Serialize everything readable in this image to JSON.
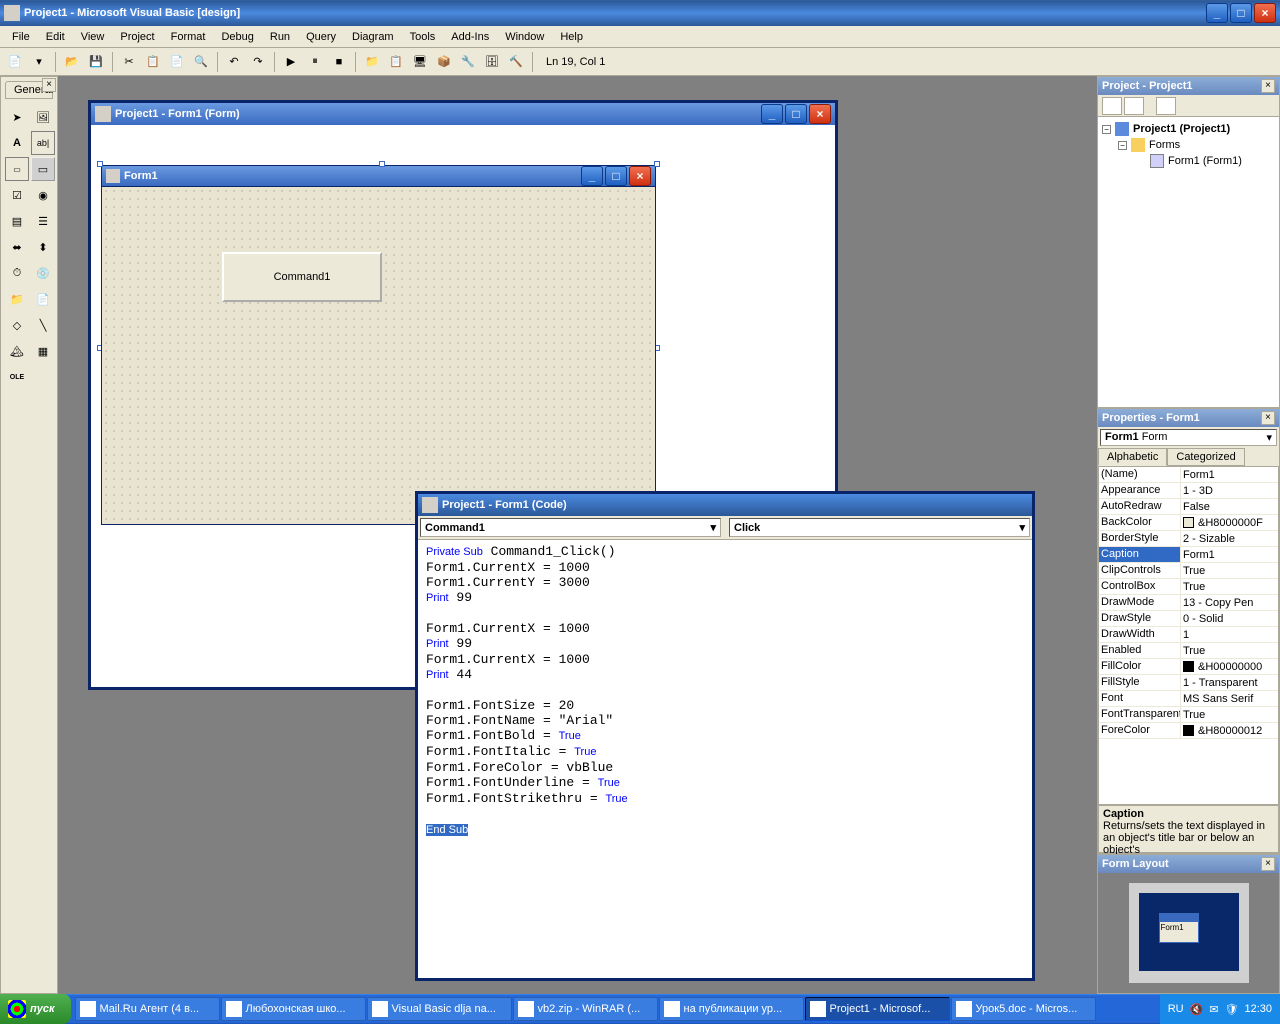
{
  "title": "Project1 - Microsoft Visual Basic [design]",
  "menu": [
    "File",
    "Edit",
    "View",
    "Project",
    "Format",
    "Debug",
    "Run",
    "Query",
    "Diagram",
    "Tools",
    "Add-Ins",
    "Window",
    "Help"
  ],
  "cursor_status": "Ln 19, Col 1",
  "toolbox_tab": "General",
  "designer_title": "Project1 - Form1 (Form)",
  "form_caption": "Form1",
  "command_caption": "Command1",
  "code_title": "Project1 - Form1 (Code)",
  "code_object": "Command1",
  "code_event": "Click",
  "code_lines": [
    {
      "t": "kw",
      "s": "Private Sub"
    },
    {
      "t": "",
      "s": " Command1_Click()"
    },
    {
      "t": "br"
    },
    {
      "t": "",
      "s": "Form1.CurrentX = 1000"
    },
    {
      "t": "br"
    },
    {
      "t": "",
      "s": "Form1.CurrentY = 3000"
    },
    {
      "t": "br"
    },
    {
      "t": "kw",
      "s": "Print"
    },
    {
      "t": "",
      "s": " 99"
    },
    {
      "t": "br"
    },
    {
      "t": "br"
    },
    {
      "t": "",
      "s": "Form1.CurrentX = 1000"
    },
    {
      "t": "br"
    },
    {
      "t": "kw",
      "s": "Print"
    },
    {
      "t": "",
      "s": " 99"
    },
    {
      "t": "br"
    },
    {
      "t": "",
      "s": "Form1.CurrentX = 1000"
    },
    {
      "t": "br"
    },
    {
      "t": "kw",
      "s": "Print"
    },
    {
      "t": "",
      "s": " 44"
    },
    {
      "t": "br"
    },
    {
      "t": "br"
    },
    {
      "t": "",
      "s": "Form1.FontSize = 20"
    },
    {
      "t": "br"
    },
    {
      "t": "",
      "s": "Form1.FontName = \"Arial\""
    },
    {
      "t": "br"
    },
    {
      "t": "",
      "s": "Form1.FontBold = "
    },
    {
      "t": "kw",
      "s": "True"
    },
    {
      "t": "br"
    },
    {
      "t": "",
      "s": "Form1.FontItalic = "
    },
    {
      "t": "kw",
      "s": "True"
    },
    {
      "t": "br"
    },
    {
      "t": "",
      "s": "Form1.ForeColor = vbBlue"
    },
    {
      "t": "br"
    },
    {
      "t": "",
      "s": "Form1.FontUnderline = "
    },
    {
      "t": "kw",
      "s": "True"
    },
    {
      "t": "br"
    },
    {
      "t": "",
      "s": "Form1.FontStrikethru = "
    },
    {
      "t": "kw",
      "s": "True"
    },
    {
      "t": "br"
    },
    {
      "t": "br"
    },
    {
      "t": "end",
      "s": "End Sub"
    }
  ],
  "project_panel_title": "Project - Project1",
  "tree": {
    "root": "Project1 (Project1)",
    "folder": "Forms",
    "item": "Form1 (Form1)"
  },
  "properties_title": "Properties - Form1",
  "properties_object_name": "Form1",
  "properties_object_type": "Form",
  "properties_tabs": [
    "Alphabetic",
    "Categorized"
  ],
  "properties": [
    {
      "n": "(Name)",
      "v": "Form1"
    },
    {
      "n": "Appearance",
      "v": "1 - 3D"
    },
    {
      "n": "AutoRedraw",
      "v": "False"
    },
    {
      "n": "BackColor",
      "v": "&H8000000F",
      "c": "#ece9d8"
    },
    {
      "n": "BorderStyle",
      "v": "2 - Sizable"
    },
    {
      "n": "Caption",
      "v": "Form1",
      "sel": true
    },
    {
      "n": "ClipControls",
      "v": "True"
    },
    {
      "n": "ControlBox",
      "v": "True"
    },
    {
      "n": "DrawMode",
      "v": "13 - Copy Pen"
    },
    {
      "n": "DrawStyle",
      "v": "0 - Solid"
    },
    {
      "n": "DrawWidth",
      "v": "1"
    },
    {
      "n": "Enabled",
      "v": "True"
    },
    {
      "n": "FillColor",
      "v": "&H00000000",
      "c": "#000"
    },
    {
      "n": "FillStyle",
      "v": "1 - Transparent"
    },
    {
      "n": "Font",
      "v": "MS Sans Serif"
    },
    {
      "n": "FontTransparent",
      "v": "True"
    },
    {
      "n": "ForeColor",
      "v": "&H80000012",
      "c": "#000"
    }
  ],
  "prop_desc_title": "Caption",
  "prop_desc_text": "Returns/sets the text displayed in an object's title bar or below an object's",
  "layout_title": "Form Layout",
  "layout_form": "Form1",
  "start_label": "пуск",
  "tasks": [
    "Mail.Ru Агент (4 в...",
    "Любохонская шко...",
    "Visual Basic dlja na...",
    "vb2.zip - WinRAR (...",
    "на публикации ур...",
    "Project1 - Microsof...",
    "Урок5.doc - Micros..."
  ],
  "tray_lang": "RU",
  "tray_time": "12:30"
}
